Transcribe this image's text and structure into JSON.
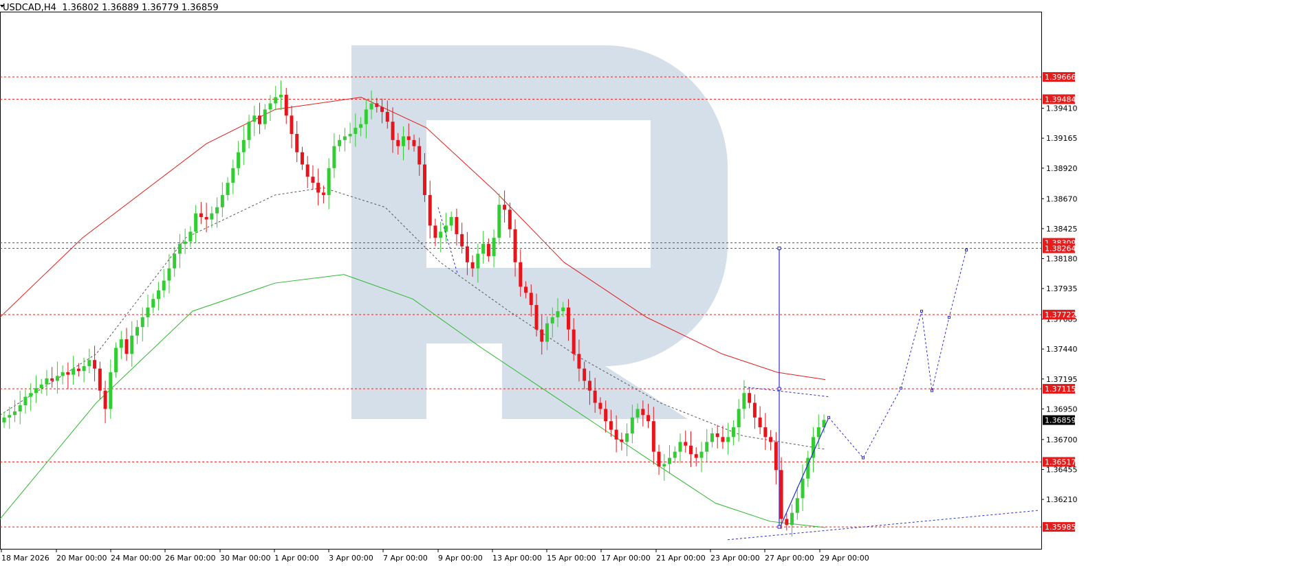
{
  "chart_data": {
    "type": "candlestick",
    "title": "USDCAD,H4  1.36802 1.36889 1.36779 1.36859",
    "symbol": "USDCAD",
    "timeframe": "H4",
    "ohlc_header": {
      "open": 1.36802,
      "high": 1.36889,
      "low": 1.36779,
      "close": 1.36859
    },
    "last_price": "1.36859",
    "ylim": [
      1.358,
      1.402
    ],
    "y_ticks": [
      "1.39410",
      "1.39165",
      "1.38920",
      "1.38670",
      "1.38425",
      "1.38180",
      "1.37935",
      "1.37685",
      "1.37440",
      "1.37195",
      "1.36950",
      "1.36700",
      "1.36455",
      "1.36210"
    ],
    "x_ticks": [
      "18 Mar 2026",
      "20 Mar 00:00",
      "24 Mar 00:00",
      "26 Mar 00:00",
      "30 Mar 00:00",
      "1 Apr 00:00",
      "3 Apr 00:00",
      "7 Apr 00:00",
      "9 Apr 00:00",
      "13 Apr 00:00",
      "15 Apr 00:00",
      "17 Apr 00:00",
      "21 Apr 00:00",
      "23 Apr 00:00",
      "27 Apr 00:00",
      "29 Apr 00:00"
    ],
    "levels": [
      {
        "value": 1.39666,
        "label": "1.39666"
      },
      {
        "value": 1.39484,
        "label": "1.39484"
      },
      {
        "value": 1.38309,
        "label": "1.38309"
      },
      {
        "value": 1.38264,
        "label": "1.38264"
      },
      {
        "value": 1.37722,
        "label": "1.37722"
      },
      {
        "value": 1.37115,
        "label": "1.37115"
      },
      {
        "value": 1.36517,
        "label": "1.36517"
      },
      {
        "value": 1.35985,
        "label": "1.35985"
      }
    ],
    "close_path": [
      1.3688,
      1.369,
      1.3693,
      1.3698,
      1.3705,
      1.3708,
      1.3712,
      1.3715,
      1.372,
      1.3718,
      1.3722,
      1.3725,
      1.3723,
      1.3728,
      1.3726,
      1.373,
      1.3735,
      1.3728,
      1.371,
      1.3695,
      1.3725,
      1.3745,
      1.3752,
      1.374,
      1.3755,
      1.3762,
      1.377,
      1.3778,
      1.3785,
      1.3792,
      1.38,
      1.381,
      1.3822,
      1.383,
      1.3832,
      1.384,
      1.3855,
      1.3852,
      1.385,
      1.3855,
      1.386,
      1.387,
      1.388,
      1.3892,
      1.3905,
      1.3915,
      1.393,
      1.3935,
      1.3928,
      1.394,
      1.3945,
      1.395,
      1.3952,
      1.3935,
      1.392,
      1.3905,
      1.3895,
      1.3885,
      1.388,
      1.3872,
      1.387,
      1.3892,
      1.391,
      1.3915,
      1.3918,
      1.392,
      1.3925,
      1.3928,
      1.394,
      1.3945,
      1.3942,
      1.3938,
      1.393,
      1.3915,
      1.391,
      1.3918,
      1.3915,
      1.391,
      1.3895,
      1.387,
      1.3845,
      1.3835,
      1.384,
      1.3845,
      1.3852,
      1.3838,
      1.3828,
      1.3815,
      1.381,
      1.3822,
      1.383,
      1.382,
      1.3835,
      1.3862,
      1.3858,
      1.3842,
      1.3815,
      1.3795,
      1.379,
      1.378,
      1.376,
      1.375,
      1.3765,
      1.377,
      1.3775,
      1.3778,
      1.376,
      1.374,
      1.3728,
      1.3718,
      1.371,
      1.37,
      1.3695,
      1.3685,
      1.3678,
      1.367,
      1.3668,
      1.3675,
      1.3688,
      1.3695,
      1.369,
      1.3685,
      1.366,
      1.3648,
      1.365,
      1.3655,
      1.366,
      1.3668,
      1.3665,
      1.3658,
      1.3655,
      1.366,
      1.3668,
      1.3675,
      1.3672,
      1.3668,
      1.3672,
      1.368,
      1.3695,
      1.3708,
      1.37,
      1.3688,
      1.368,
      1.3672,
      1.3668,
      1.3645,
      1.3605,
      1.36,
      1.361,
      1.3622,
      1.3638,
      1.3655,
      1.3672,
      1.368,
      1.3686
    ],
    "ma_red": [
      [
        0,
        1.377
      ],
      [
        120,
        1.3835
      ],
      [
        300,
        1.3912
      ],
      [
        400,
        1.394
      ],
      [
        525,
        1.395
      ],
      [
        620,
        1.3925
      ],
      [
        720,
        1.3873
      ],
      [
        820,
        1.3815
      ],
      [
        940,
        1.377
      ],
      [
        1050,
        1.374
      ],
      [
        1130,
        1.3725
      ],
      [
        1200,
        1.3719
      ]
    ],
    "ma_dotted": [
      [
        0,
        1.369
      ],
      [
        140,
        1.374
      ],
      [
        270,
        1.3835
      ],
      [
        400,
        1.387
      ],
      [
        470,
        1.3876
      ],
      [
        560,
        1.386
      ],
      [
        640,
        1.3815
      ],
      [
        740,
        1.3775
      ],
      [
        840,
        1.3738
      ],
      [
        960,
        1.37
      ],
      [
        1080,
        1.3673
      ],
      [
        1200,
        1.3662
      ]
    ],
    "ma_green": [
      [
        0,
        1.3605
      ],
      [
        140,
        1.37
      ],
      [
        280,
        1.3775
      ],
      [
        400,
        1.3798
      ],
      [
        500,
        1.3805
      ],
      [
        600,
        1.3785
      ],
      [
        700,
        1.3745
      ],
      [
        820,
        1.37
      ],
      [
        940,
        1.3655
      ],
      [
        1040,
        1.3618
      ],
      [
        1120,
        1.3603
      ],
      [
        1200,
        1.3598
      ]
    ],
    "forecast": [
      [
        1205,
        1.3688
      ],
      [
        1255,
        1.3655
      ],
      [
        1310,
        1.3712
      ],
      [
        1340,
        1.3775
      ],
      [
        1355,
        1.371
      ],
      [
        1380,
        1.377
      ],
      [
        1405,
        1.3825
      ]
    ],
    "pattern": [
      [
        637,
        1.386
      ],
      [
        665,
        1.3806
      ],
      [
        1082,
        1.3713
      ],
      [
        1205,
        1.3705
      ],
      [
        1134,
        1.3598
      ],
      [
        1205,
        1.3688
      ]
    ],
    "vline": {
      "x": 1133,
      "from": 1.35985,
      "to": 1.38264
    },
    "trendline": [
      [
        1058,
        1.3588
      ],
      [
        1510,
        1.3612
      ]
    ]
  }
}
